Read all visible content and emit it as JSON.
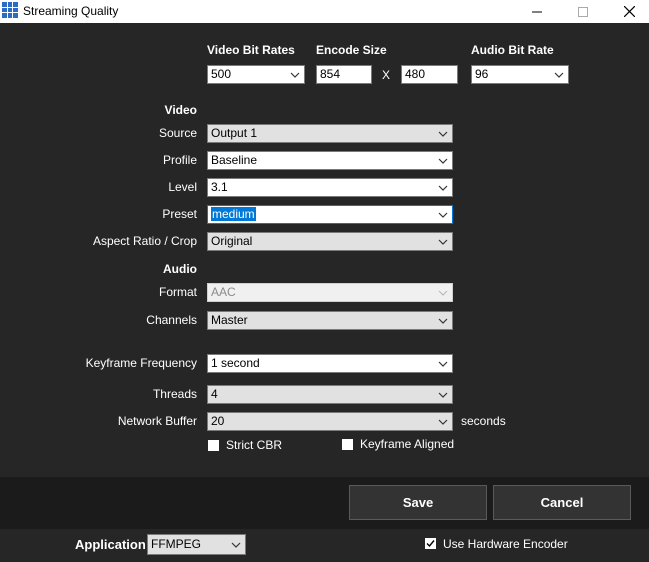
{
  "window": {
    "title": "Streaming Quality"
  },
  "header": {
    "video_bit_rates": "Video Bit Rates",
    "encode_size": "Encode Size",
    "audio_bit_rate": "Audio Bit Rate",
    "video_bit_rate_value": "500",
    "width_value": "854",
    "x_label": "X",
    "height_value": "480",
    "audio_bit_rate_value": "96"
  },
  "video": {
    "section_label": "Video",
    "source_label": "Source",
    "source_value": "Output 1",
    "profile_label": "Profile",
    "profile_value": "Baseline",
    "level_label": "Level",
    "level_value": "3.1",
    "preset_label": "Preset",
    "preset_value": "medium",
    "aspect_label": "Aspect Ratio / Crop",
    "aspect_value": "Original"
  },
  "audio": {
    "section_label": "Audio",
    "format_label": "Format",
    "format_value": "AAC",
    "channels_label": "Channels",
    "channels_value": "Master"
  },
  "advanced": {
    "keyframe_label": "Keyframe Frequency",
    "keyframe_value": "1 second",
    "threads_label": "Threads",
    "threads_value": "4",
    "network_buffer_label": "Network Buffer",
    "network_buffer_value": "20",
    "seconds_label": "seconds",
    "strict_cbr_label": "Strict CBR",
    "strict_cbr_checked": false,
    "keyframe_aligned_label": "Keyframe Aligned",
    "keyframe_aligned_checked": false
  },
  "actions": {
    "save": "Save",
    "cancel": "Cancel"
  },
  "bottom": {
    "application_label": "Application",
    "application_value": "FFMPEG",
    "hw_encoder_label": "Use Hardware Encoder",
    "hw_encoder_checked": true
  },
  "colors": {
    "background": "#262626",
    "footer": "#1b1b1b",
    "accent": "#0078d7"
  },
  "icons": [
    "app-grid-icon",
    "minimize-icon",
    "maximize-icon",
    "close-icon",
    "chevron-down-icon",
    "checkmark-icon"
  ]
}
